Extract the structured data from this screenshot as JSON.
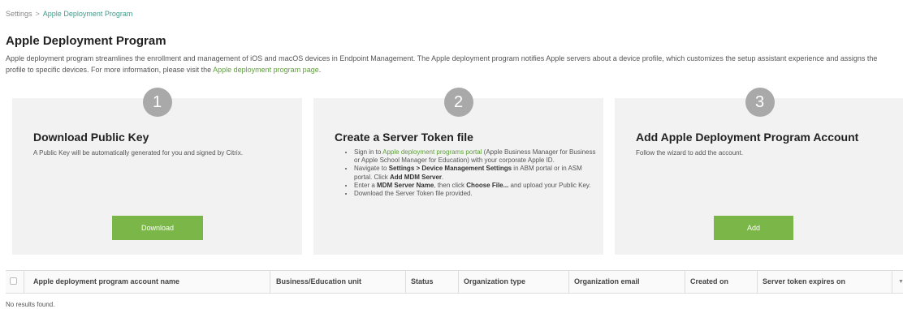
{
  "breadcrumb": {
    "parent": "Settings",
    "separator": ">",
    "current": "Apple Deployment Program"
  },
  "page": {
    "title": "Apple Deployment Program",
    "description": "Apple deployment program streamlines the enrollment and management of iOS and macOS devices in Endpoint Management. The Apple deployment program notifies Apple servers about a device profile, which customizes the setup assistant experience and assigns the profile to specific devices. For more information, please visit the ",
    "description_link": "Apple deployment program page",
    "description_end": "."
  },
  "steps": [
    {
      "number": "1",
      "title": "Download Public Key",
      "text": "A Public Key will be automatically generated for you and signed by Citrix.",
      "button": "Download"
    },
    {
      "number": "2",
      "title": "Create a Server Token file",
      "items": [
        {
          "a": "Sign in to ",
          "link": "Apple deployment programs portal",
          "b": " (Apple Business Manager for Business or Apple School Manager for Education) with your corporate Apple ID."
        },
        {
          "a": "Navigate to ",
          "bold1": "Settings > Device Management Settings",
          "b": " in ABM portal or in ASM portal. Click ",
          "bold2": "Add MDM Server",
          "c": "."
        },
        {
          "a": "Enter a ",
          "bold1": "MDM Server Name",
          "b": ", then click ",
          "bold2": "Choose File...",
          "c": " and upload your Public Key."
        },
        {
          "a": "Download the Server Token file provided."
        }
      ]
    },
    {
      "number": "3",
      "title": "Add Apple Deployment Program Account",
      "text": "Follow the wizard to add the account.",
      "button": "Add"
    }
  ],
  "table": {
    "columns": [
      "Apple deployment program account name",
      "Business/Education unit",
      "Status",
      "Organization type",
      "Organization email",
      "Created on",
      "Server token expires on"
    ],
    "sort_icon": "chevron-down-icon",
    "empty_text": "No results found."
  },
  "colors": {
    "accent": "#7ab648",
    "link": "#5e9e3a",
    "breadcrumb_current": "#3d9a8b"
  }
}
